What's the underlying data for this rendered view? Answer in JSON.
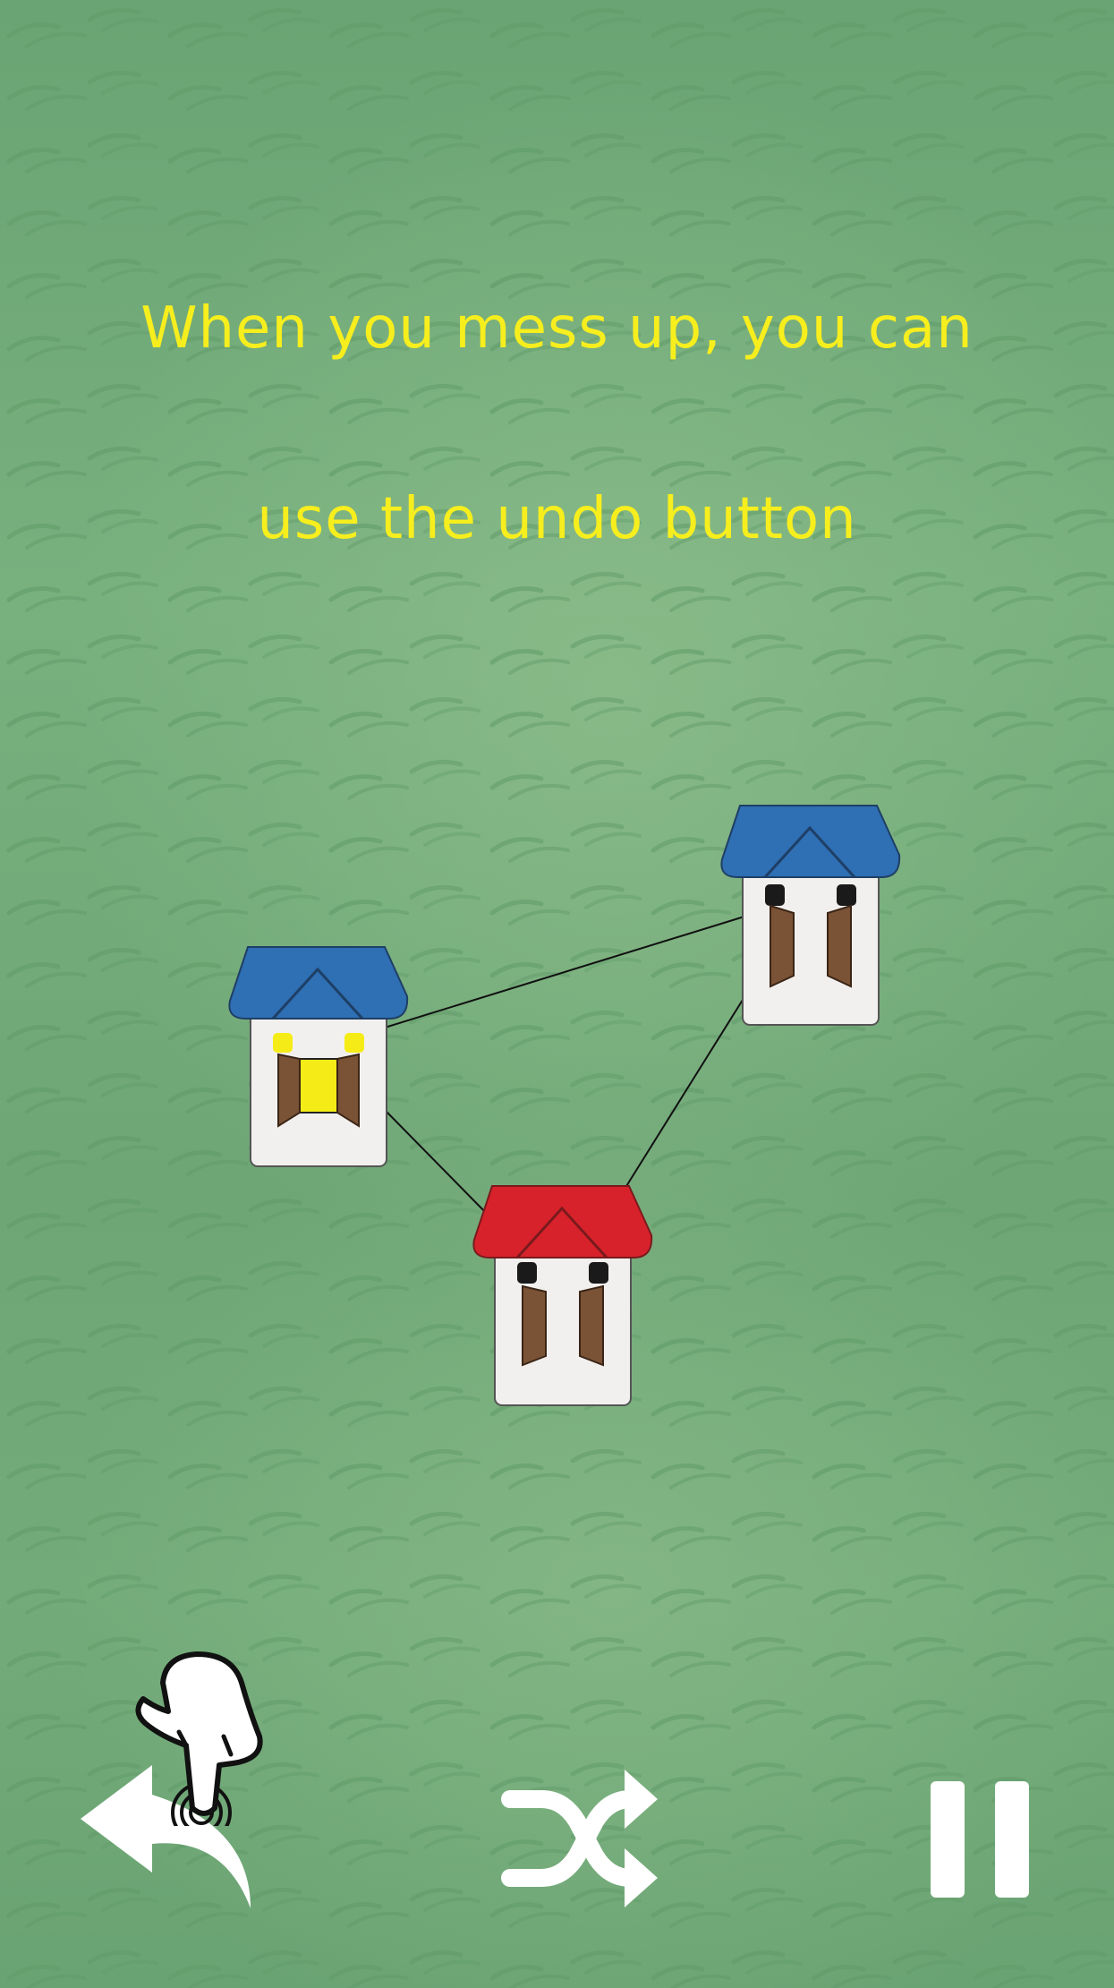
{
  "tutorial": {
    "line1": "When you mess up, you can",
    "line2": "use the undo button"
  },
  "houses": [
    {
      "name": "house-blue-left",
      "roof_color": "#2f6fb3",
      "window_color": "#f5ec17",
      "door_color": "#f5ec17",
      "state": "selected"
    },
    {
      "name": "house-blue-right",
      "roof_color": "#2f6fb3",
      "window_color": "#1a1a1a",
      "door_color": "#7a5235",
      "state": "normal"
    },
    {
      "name": "house-red-bottom",
      "roof_color": "#d8222b",
      "window_color": "#1a1a1a",
      "door_color": "#7a5235",
      "state": "normal"
    }
  ],
  "controls": {
    "undo_icon": "undo-arrow-icon",
    "shuffle_icon": "shuffle-icon",
    "pause_icon": "pause-icon",
    "hint_icon": "tap-hand-icon"
  },
  "colors": {
    "text": "#f7ee1d",
    "background": "#6ea676",
    "icon": "#ffffff"
  }
}
